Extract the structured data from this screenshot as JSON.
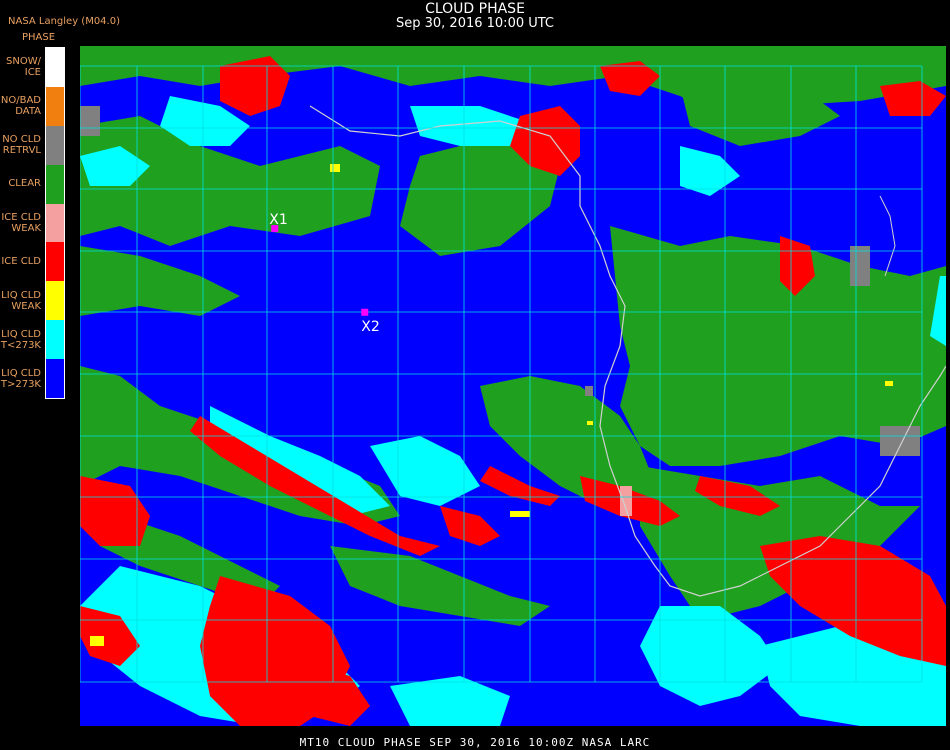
{
  "title": "CLOUD PHASE",
  "subtitle": "Sep 30, 2016 10:00 UTC",
  "provider": "NASA Langley (M04.0)",
  "legend": {
    "title": "PHASE",
    "items": [
      {
        "label1": "SNOW/",
        "label2": "ICE",
        "color": "#ffffff"
      },
      {
        "label1": "NO/BAD",
        "label2": "DATA",
        "color": "#f07f10"
      },
      {
        "label1": "NO CLD",
        "label2": "RETRVL",
        "color": "#808080"
      },
      {
        "label1": "CLEAR",
        "label2": "",
        "color": "#1fa01f"
      },
      {
        "label1": "ICE CLD",
        "label2": "WEAK",
        "color": "#f5a0a0"
      },
      {
        "label1": "ICE CLD",
        "label2": "",
        "color": "#ff0000"
      },
      {
        "label1": "LIQ CLD",
        "label2": "WEAK",
        "color": "#ffff00"
      },
      {
        "label1": "LIQ CLD",
        "label2": "T<273K",
        "color": "#00ffff"
      },
      {
        "label1": "LIQ CLD",
        "label2": "T>273K",
        "color": "#0000ff"
      }
    ]
  },
  "markers": [
    {
      "label": "X1",
      "lon": 1.5,
      "lat": -10.5,
      "color": "#ff00ff"
    },
    {
      "label": "X2",
      "lon": 6.8,
      "lat": -15.3,
      "color": "#ff00ff"
    }
  ],
  "grid_color": "#00e0e0",
  "coastline_color": "#d0d0d0",
  "footer": "MT10  CLOUD PHASE   SEP 30, 2016 10:00Z   NASA LARC"
}
